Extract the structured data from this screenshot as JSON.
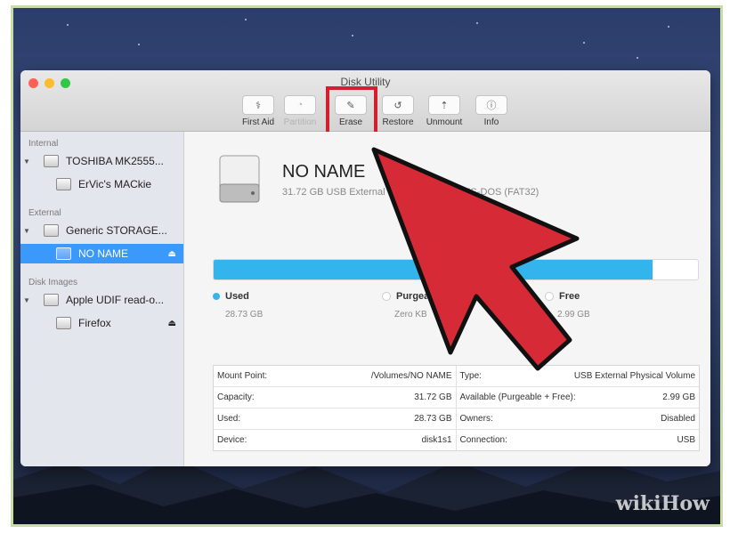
{
  "window": {
    "title": "Disk Utility"
  },
  "toolbar": [
    {
      "label": "First Aid",
      "icon": "stethoscope-icon",
      "glyph": "⚕",
      "enabled": true
    },
    {
      "label": "Partition",
      "icon": "partition-icon",
      "glyph": "◔",
      "enabled": false
    },
    {
      "label": "Erase",
      "icon": "erase-icon",
      "glyph": "✎",
      "enabled": true
    },
    {
      "label": "Restore",
      "icon": "restore-icon",
      "glyph": "↺",
      "enabled": true
    },
    {
      "label": "Unmount",
      "icon": "unmount-icon",
      "glyph": "⇡",
      "enabled": true
    },
    {
      "label": "Info",
      "icon": "info-icon",
      "glyph": "ⓘ",
      "enabled": true
    }
  ],
  "sidebar": {
    "internal_label": "Internal",
    "external_label": "External",
    "images_label": "Disk Images",
    "items": [
      {
        "label": "TOSHIBA MK2555...",
        "disclosure": "▼"
      },
      {
        "label": "ErVic's MACkie"
      },
      {
        "label": "Generic STORAGE...",
        "disclosure": "▼"
      },
      {
        "label": "NO NAME",
        "eject": "⏏"
      },
      {
        "label": "Apple UDIF read-o...",
        "disclosure": "▼"
      },
      {
        "label": "Firefox",
        "eject": "⏏"
      }
    ]
  },
  "volume": {
    "name": "NO NAME",
    "subtitle": "31.72 GB USB External Physical Volume MS-DOS (FAT32)",
    "used_fraction": 0.906
  },
  "legend": [
    {
      "title": "Used",
      "value": "28.73 GB",
      "color": "#34b4ec"
    },
    {
      "title": "Purgeable",
      "value": "Zero KB",
      "color": "#ffffff"
    },
    {
      "title": "Free",
      "value": "2.99 GB",
      "color": "#ffffff"
    }
  ],
  "info_rows": [
    {
      "k1": "Mount Point:",
      "v1": "/Volumes/NO NAME",
      "k2": "Type:",
      "v2": "USB External Physical Volume"
    },
    {
      "k1": "Capacity:",
      "v1": "31.72 GB",
      "k2": "Available (Purgeable + Free):",
      "v2": "2.99 GB"
    },
    {
      "k1": "Used:",
      "v1": "28.73 GB",
      "k2": "Owners:",
      "v2": "Disabled"
    },
    {
      "k1": "Device:",
      "v1": "disk1s1",
      "k2": "Connection:",
      "v2": "USB"
    }
  ],
  "watermark": "wikiHow",
  "colors": {
    "accent": "#3b99fc",
    "highlight_box": "#d3202f",
    "arrow": "#d62a37",
    "used_bar": "#34b4ec"
  }
}
